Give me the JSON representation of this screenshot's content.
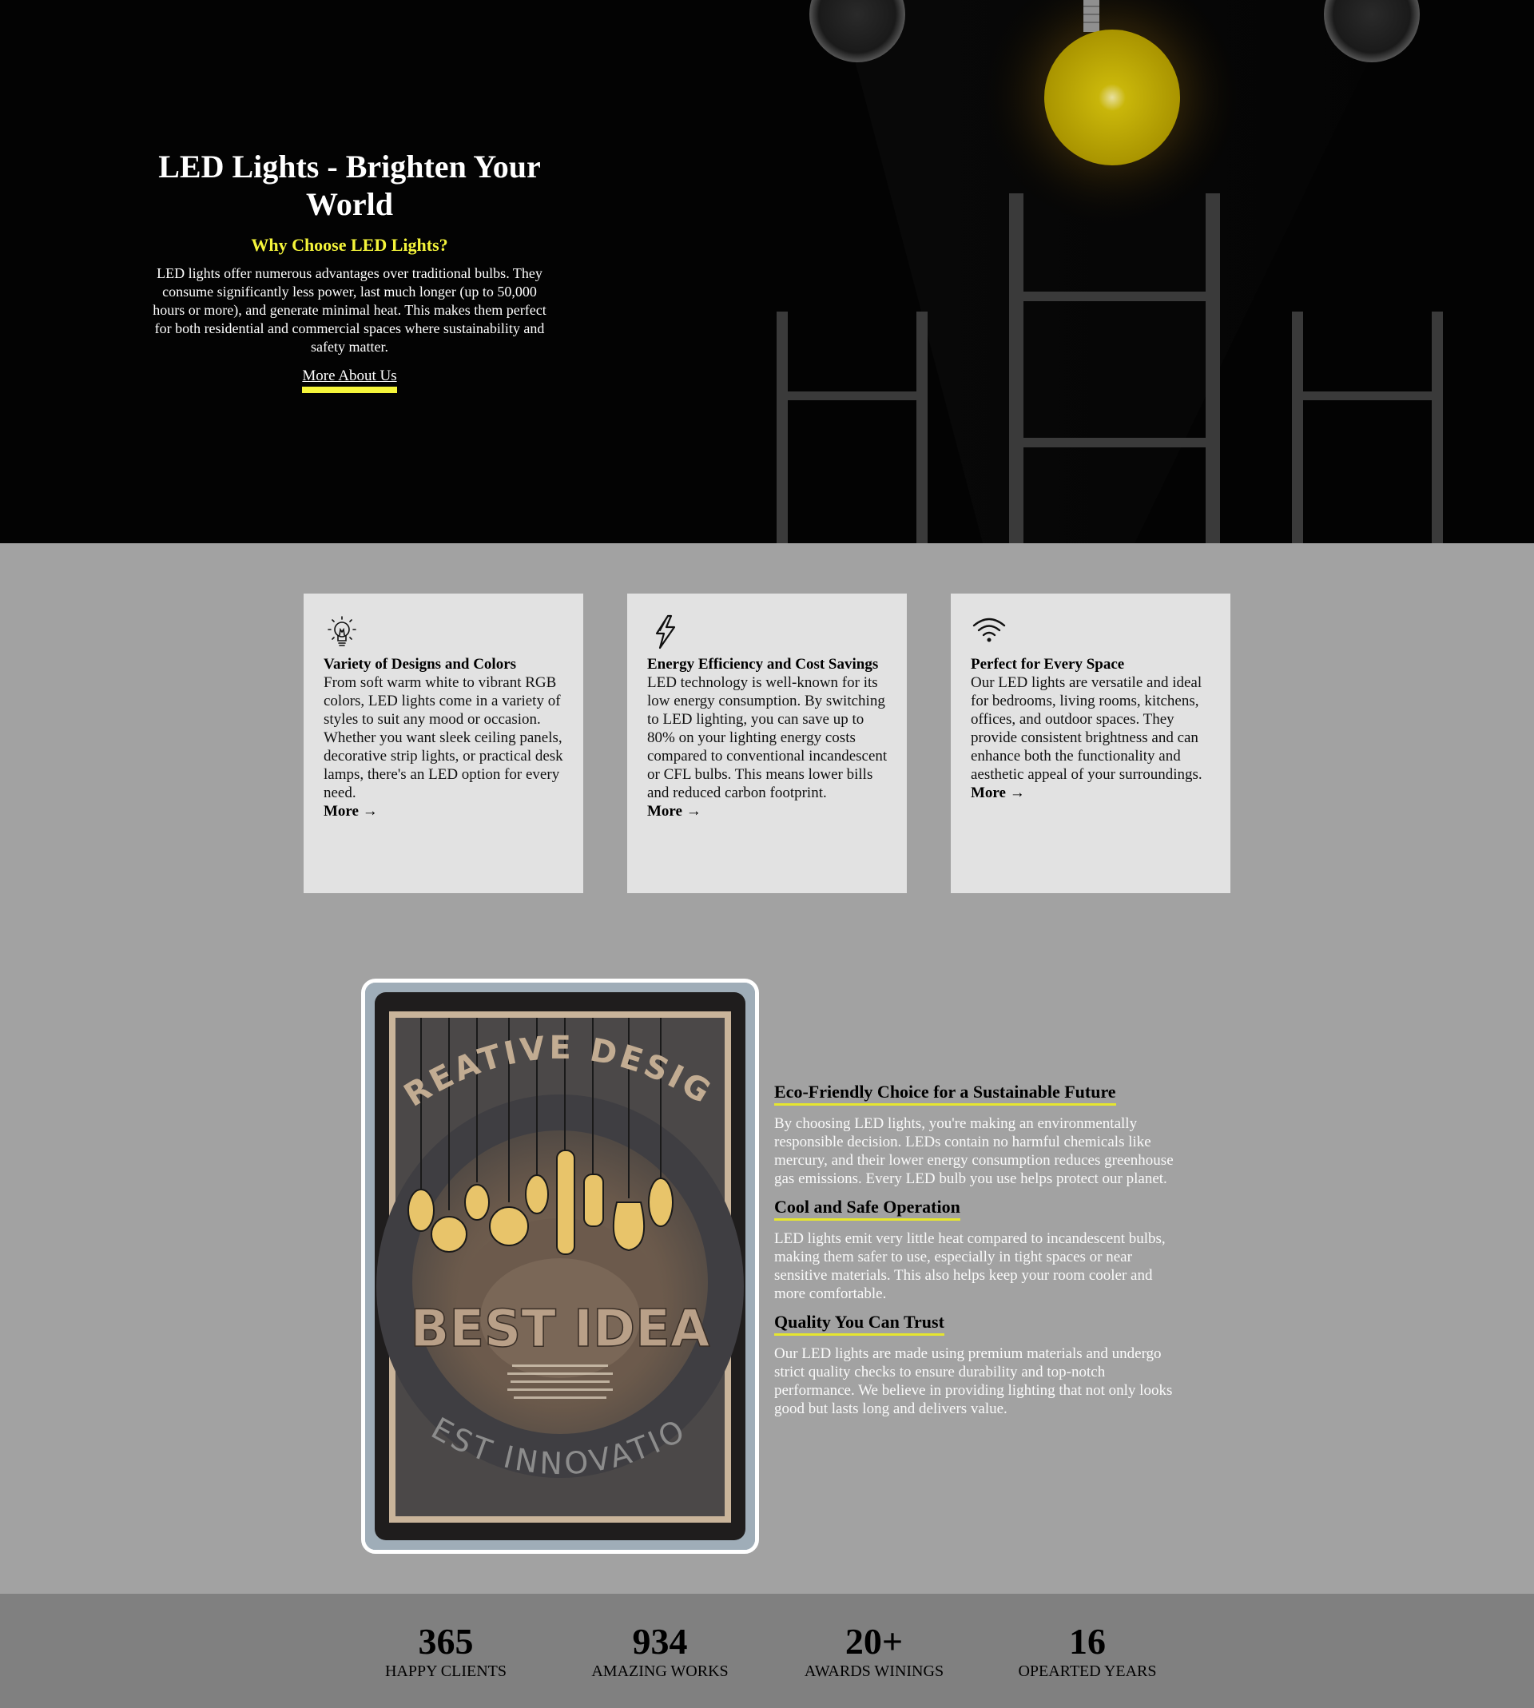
{
  "hero": {
    "title": "LED Lights - Brighten Your World",
    "subtitle": "Why Choose LED Lights?",
    "body": "LED lights offer numerous advantages over traditional bulbs. They consume significantly less power, last much longer (up to 50,000 hours or more), and generate minimal heat. This makes them perfect for both residential and commercial spaces where sustainability and safety matter.",
    "cta": "More About Us",
    "accent_color": "#f5f53a"
  },
  "cards": [
    {
      "icon": "lightbulb-icon",
      "title": "Variety of Designs and Colors",
      "text": "From soft warm white to vibrant RGB colors, LED lights come in a variety of styles to suit any mood or occasion. Whether you want sleek ceiling panels, decorative strip lights, or practical desk lamps, there's an LED option for every need.",
      "more": "More →"
    },
    {
      "icon": "lightning-icon",
      "title": "Energy Efficiency and Cost Savings",
      "text": "LED technology is well-known for its low energy consumption. By switching to LED lighting, you can save up to 80% on your lighting energy costs compared to conventional incandescent or CFL bulbs. This means lower bills and reduced carbon footprint.",
      "more": "More →"
    },
    {
      "icon": "wifi-icon",
      "title": "Perfect for Every Space",
      "text": "Our LED lights are versatile and ideal for bedrooms, living rooms, kitchens, offices, and outdoor spaces. They provide consistent brightness and can enhance both the functionality and aesthetic appeal of your surroundings.",
      "more": "More →"
    }
  ],
  "poster": {
    "top_text": "CREATIVE DESIGN",
    "middle_text": "BEST IDEA",
    "bottom_text": "BEST INNOVATION"
  },
  "features": [
    {
      "title": "Eco-Friendly Choice for a Sustainable Future",
      "text": "By choosing LED lights, you're making an environmentally responsible decision. LEDs contain no harmful chemicals like mercury, and their lower energy consumption reduces greenhouse gas emissions. Every LED bulb you use helps protect our planet."
    },
    {
      "title": "Cool and Safe Operation",
      "text": "LED lights emit very little heat compared to incandescent bulbs, making them safer to use, especially in tight spaces or near sensitive materials. This also helps keep your room cooler and more comfortable."
    },
    {
      "title": "Quality You Can Trust",
      "text": "Our LED lights are made using premium materials and undergo strict quality checks to ensure durability and top-notch performance. We believe in providing lighting that not only looks good but lasts long and delivers value."
    }
  ],
  "stats": [
    {
      "value": "365",
      "label": "HAPPY CLIENTS"
    },
    {
      "value": "934",
      "label": "AMAZING WORKS"
    },
    {
      "value": "20+",
      "label": "AWARDS WININGS"
    },
    {
      "value": "16",
      "label": "OPEARTED YEARS"
    }
  ]
}
